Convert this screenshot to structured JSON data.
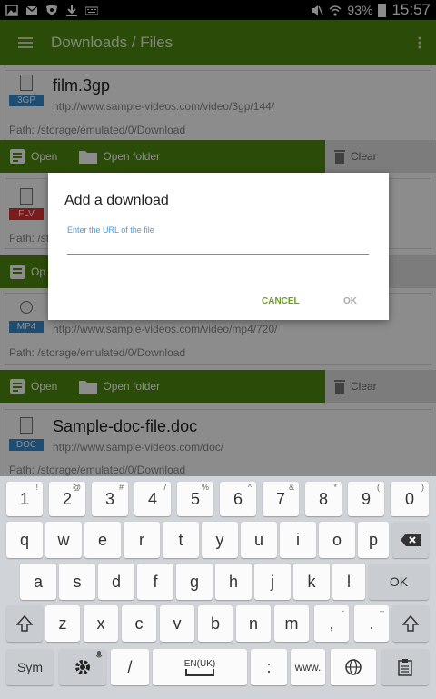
{
  "status_bar": {
    "battery": "93%",
    "time": "15:57",
    "left_icons": [
      "image-icon",
      "gmail-icon",
      "shield-icon",
      "download-icon",
      "keyboard-icon"
    ],
    "right_icons": [
      "mute-icon",
      "wifi-icon",
      "battery-icon"
    ]
  },
  "app_bar": {
    "title": "Downloads / Files",
    "color": "#4f8a10"
  },
  "downloads": [
    {
      "name": "film.3gp",
      "type_badge": "3GP",
      "badge_color": "#3a8ccf",
      "url": "http://www.sample-videos.com/video/3gp/144/",
      "path": "Path: /storage/emulated/0/Download"
    },
    {
      "name": "",
      "type_badge": "FLV",
      "badge_color": "#d33",
      "url": "",
      "path": "Path: /st"
    },
    {
      "name": "",
      "type_badge": "MP4",
      "badge_color": "#3a8ccf",
      "url": "http://www.sample-videos.com/video/mp4/720/",
      "path": "Path: /storage/emulated/0/Download"
    },
    {
      "name": "Sample-doc-file.doc",
      "type_badge": "DOC",
      "badge_color": "#3a8ccf",
      "url": "http://www.sample-videos.com/doc/",
      "path": "Path: /storage/emulated/0/Download"
    }
  ],
  "actions": {
    "open": "Open",
    "open_short": "Op",
    "open_folder": "Open folder",
    "clear": "Clear"
  },
  "dialog": {
    "title": "Add a download",
    "input_label": "Enter the URL of the file",
    "input_value": "",
    "cancel": "CANCEL",
    "ok": "OK"
  },
  "keyboard": {
    "row_numbers": [
      {
        "main": "1",
        "sup": "!"
      },
      {
        "main": "2",
        "sup": "@"
      },
      {
        "main": "3",
        "sup": "#"
      },
      {
        "main": "4",
        "sup": "/"
      },
      {
        "main": "5",
        "sup": "%"
      },
      {
        "main": "6",
        "sup": "^"
      },
      {
        "main": "7",
        "sup": "&"
      },
      {
        "main": "8",
        "sup": "*"
      },
      {
        "main": "9",
        "sup": "("
      },
      {
        "main": "0",
        "sup": ")"
      }
    ],
    "row_q": [
      "q",
      "w",
      "e",
      "r",
      "t",
      "y",
      "u",
      "i",
      "o",
      "p"
    ],
    "row_a": [
      "a",
      "s",
      "d",
      "f",
      "g",
      "h",
      "j",
      "k",
      "l"
    ],
    "row_z": [
      "z",
      "x",
      "c",
      "v",
      "b",
      "n",
      "m"
    ],
    "comma": ",",
    "comma_sup": "-",
    "period": ".",
    "period_sup": "–",
    "ok_key": "OK",
    "sym": "Sym",
    "slash": "/",
    "language": "EN(UK)",
    "colon": ":",
    "www": "www."
  }
}
